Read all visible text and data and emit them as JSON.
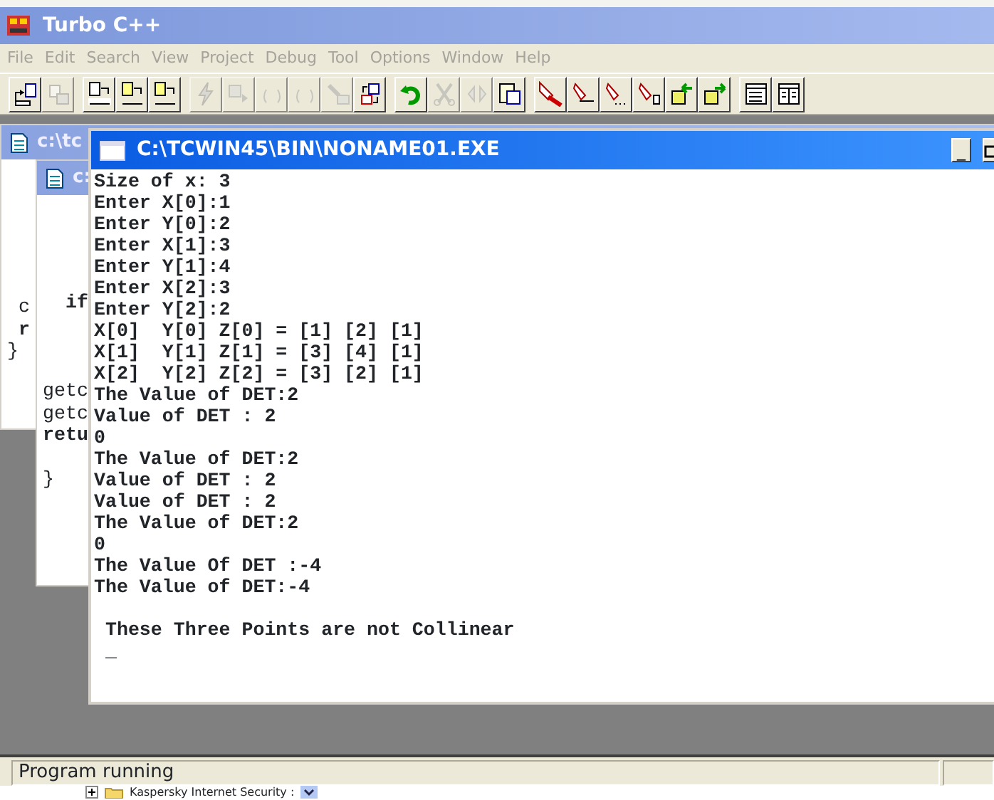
{
  "app": {
    "title": "Turbo C++"
  },
  "menu": [
    {
      "label": "File",
      "disabled": true
    },
    {
      "label": "Edit",
      "disabled": true
    },
    {
      "label": "Search",
      "disabled": true
    },
    {
      "label": "View",
      "disabled": true
    },
    {
      "label": "Project",
      "disabled": true
    },
    {
      "label": "Debug",
      "disabled": true
    },
    {
      "label": "Tool",
      "disabled": true
    },
    {
      "label": "Options",
      "disabled": true
    },
    {
      "label": "Window",
      "disabled": true
    },
    {
      "label": "Help",
      "disabled": true
    }
  ],
  "toolbar": [
    {
      "buttons": [
        {
          "disabled": false
        },
        {
          "disabled": true
        }
      ]
    },
    {
      "buttons": [
        {
          "disabled": false
        },
        {
          "disabled": false
        },
        {
          "disabled": false
        }
      ]
    },
    {
      "buttons": [
        {
          "disabled": true
        },
        {
          "disabled": true
        },
        {
          "disabled": true
        },
        {
          "disabled": true
        },
        {
          "disabled": true
        },
        {
          "disabled": false
        }
      ]
    },
    {
      "buttons": [
        {
          "disabled": false
        },
        {
          "disabled": true
        },
        {
          "disabled": true
        },
        {
          "disabled": false
        }
      ]
    },
    {
      "buttons": [
        {
          "disabled": false
        },
        {
          "disabled": false
        },
        {
          "disabled": false
        },
        {
          "disabled": false
        },
        {
          "disabled": false
        },
        {
          "disabled": false
        }
      ]
    },
    {
      "buttons": [
        {
          "disabled": false
        },
        {
          "disabled": false
        }
      ]
    }
  ],
  "editors": [
    {
      "title": "c:\\tc",
      "lines": [
        {
          "text": " c",
          "keyword": false
        },
        {
          "text": " r",
          "keyword": true
        },
        {
          "text": "}",
          "keyword": false
        }
      ]
    },
    {
      "title": "c:",
      "lines": [
        {
          "text": "  if",
          "keyword": true
        },
        {
          "text": "getc",
          "keyword": false
        },
        {
          "text": "getc",
          "keyword": false
        },
        {
          "text": "retu",
          "keyword": true
        },
        {
          "text": "}",
          "keyword": false
        }
      ]
    }
  ],
  "console": {
    "title": "C:\\TCWIN45\\BIN\\NONAME01.EXE",
    "minimize": "_",
    "lines": [
      "Size of x: 3",
      "Enter X[0]:1",
      "Enter Y[0]:2",
      "Enter X[1]:3",
      "Enter Y[1]:4",
      "Enter X[2]:3",
      "Enter Y[2]:2",
      "X[0]  Y[0] Z[0] = [1] [2] [1]",
      "X[1]  Y[1] Z[1] = [3] [4] [1]",
      "X[2]  Y[2] Z[2] = [3] [2] [1]",
      "The Value of DET:2",
      "Value of DET : 2",
      "0",
      "The Value of DET:2",
      "Value of DET : 2",
      "Value of DET : 2",
      "The Value of DET:2",
      "0",
      "The Value Of DET :-4",
      "The Value of DET:-4"
    ],
    "message": " These Three Points are not Collinear",
    "cursor": " _"
  },
  "status_bar": {
    "text": "Program running"
  },
  "taskbar_item": {
    "text": "Kaspersky Internet Security :"
  }
}
